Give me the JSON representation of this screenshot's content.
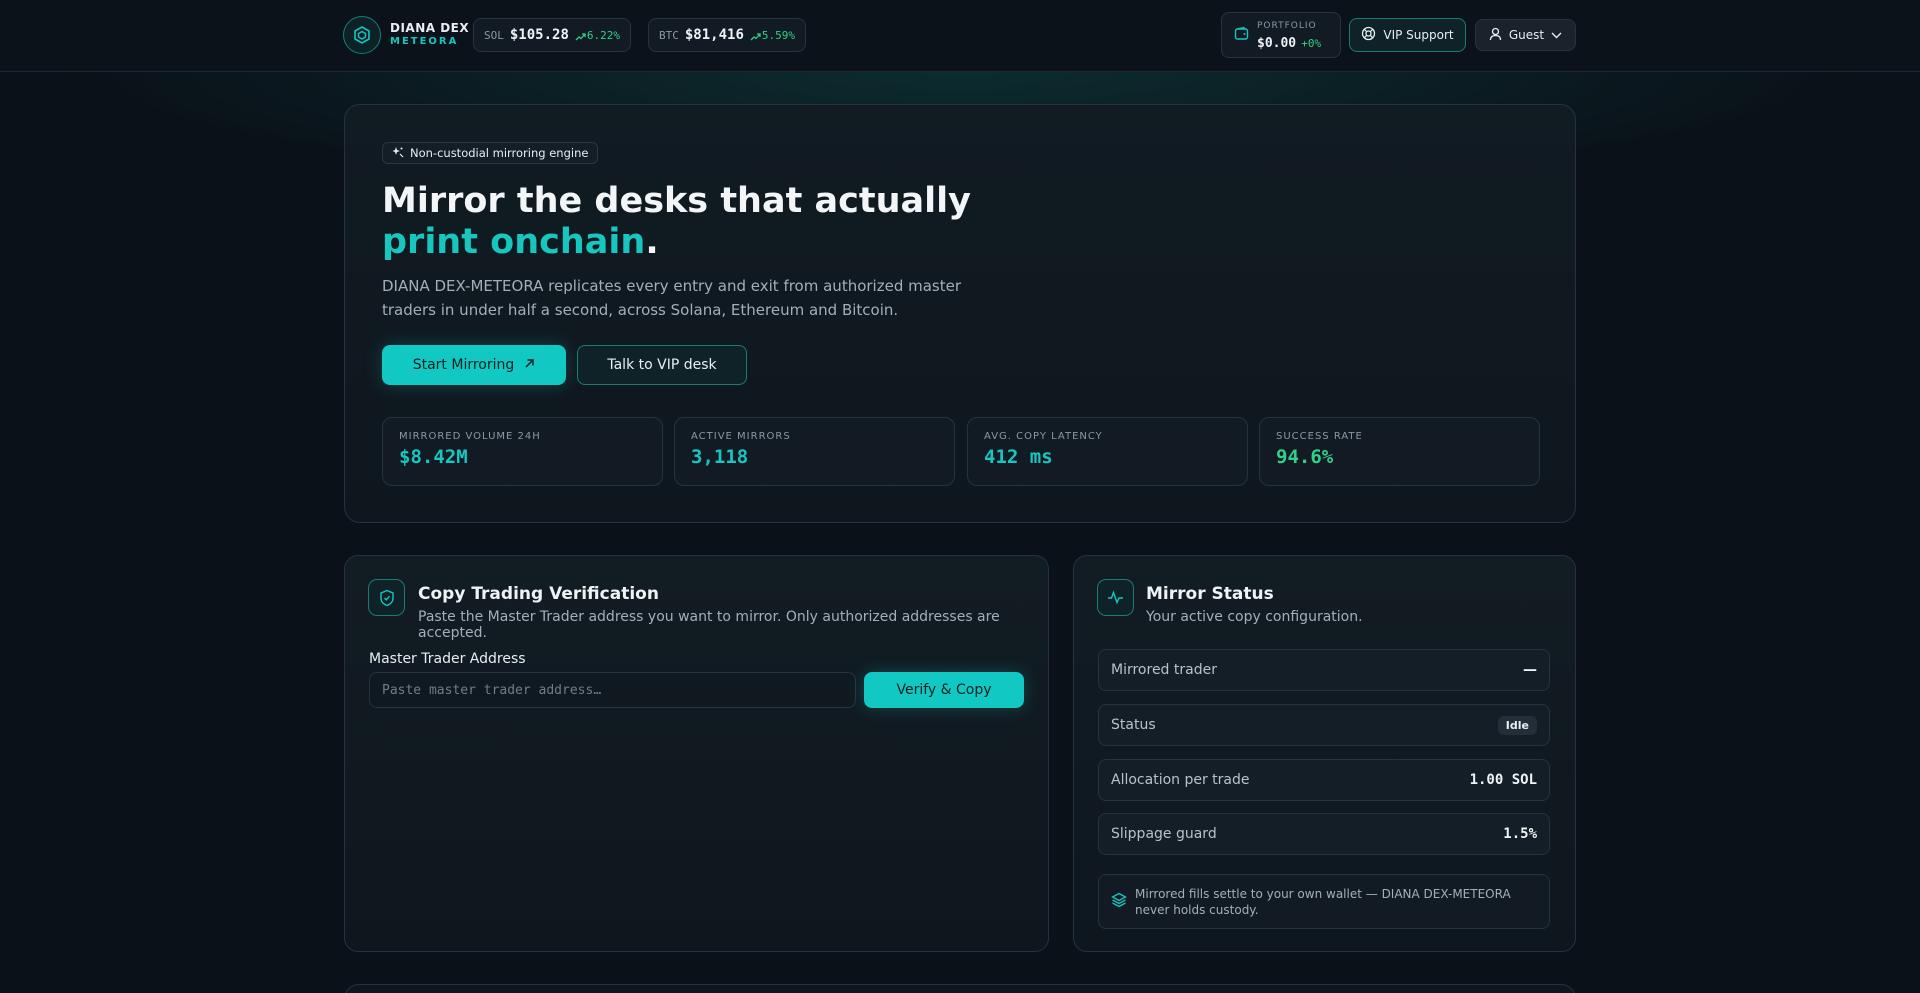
{
  "brand": {
    "name": "DIANA DEX",
    "sub": "METEORA"
  },
  "tickers": [
    {
      "symbol": "SOL",
      "price": "$105.28",
      "change": "6.22%"
    },
    {
      "symbol": "BTC",
      "price": "$81,416",
      "change": "5.59%"
    }
  ],
  "portfolio": {
    "label": "PORTFOLIO",
    "value": "$0.00",
    "change": "+0%"
  },
  "header": {
    "vip_label": "VIP Support",
    "user_label": "Guest"
  },
  "hero": {
    "badge": "Non-custodial mirroring engine",
    "title_main": "Mirror the desks that actually ",
    "title_accent": "print onchain",
    "title_end": ".",
    "description": "DIANA DEX-METEORA replicates every entry and exit from authorized master traders in under half a second, across Solana, Ethereum and Bitcoin.",
    "primary_cta": "Start Mirroring",
    "secondary_cta": "Talk to VIP desk"
  },
  "stats": [
    {
      "label": "MIRRORED VOLUME 24H",
      "value": "$8.42M"
    },
    {
      "label": "ACTIVE MIRRORS",
      "value": "3,118"
    },
    {
      "label": "AVG. COPY LATENCY",
      "value": "412 ms"
    },
    {
      "label": "SUCCESS RATE",
      "value": "94.6%"
    }
  ],
  "verification": {
    "title": "Copy Trading Verification",
    "subtitle": "Paste the Master Trader address you want to mirror. Only authorized addresses are accepted.",
    "field_label": "Master Trader Address",
    "input_value": "",
    "input_placeholder": "Paste master trader address…",
    "button_label": "Verify & Copy"
  },
  "mirror_status": {
    "title": "Mirror Status",
    "subtitle": "Your active copy configuration.",
    "rows": [
      {
        "label": "Mirrored trader",
        "value": "—"
      },
      {
        "label": "Status",
        "value": "Idle"
      },
      {
        "label": "Allocation per trade",
        "value": "1.00 SOL"
      },
      {
        "label": "Slippage guard",
        "value": "1.5%"
      }
    ],
    "note": "Mirrored fills settle to your own wallet — DIANA DEX-METEORA never holds custody."
  },
  "colors": {
    "accent": "#18c6c0",
    "positive": "#2fd18a",
    "background": "#0a1118"
  },
  "icons": {
    "brand": "hexagon-icon",
    "portfolio": "wallet-icon",
    "vip": "lifebuoy-icon",
    "user": "user-icon",
    "badge": "sparkles-icon",
    "cta": "arrow-up-right-icon",
    "verification": "shield-icon",
    "status": "activity-icon",
    "note": "layers-icon"
  }
}
